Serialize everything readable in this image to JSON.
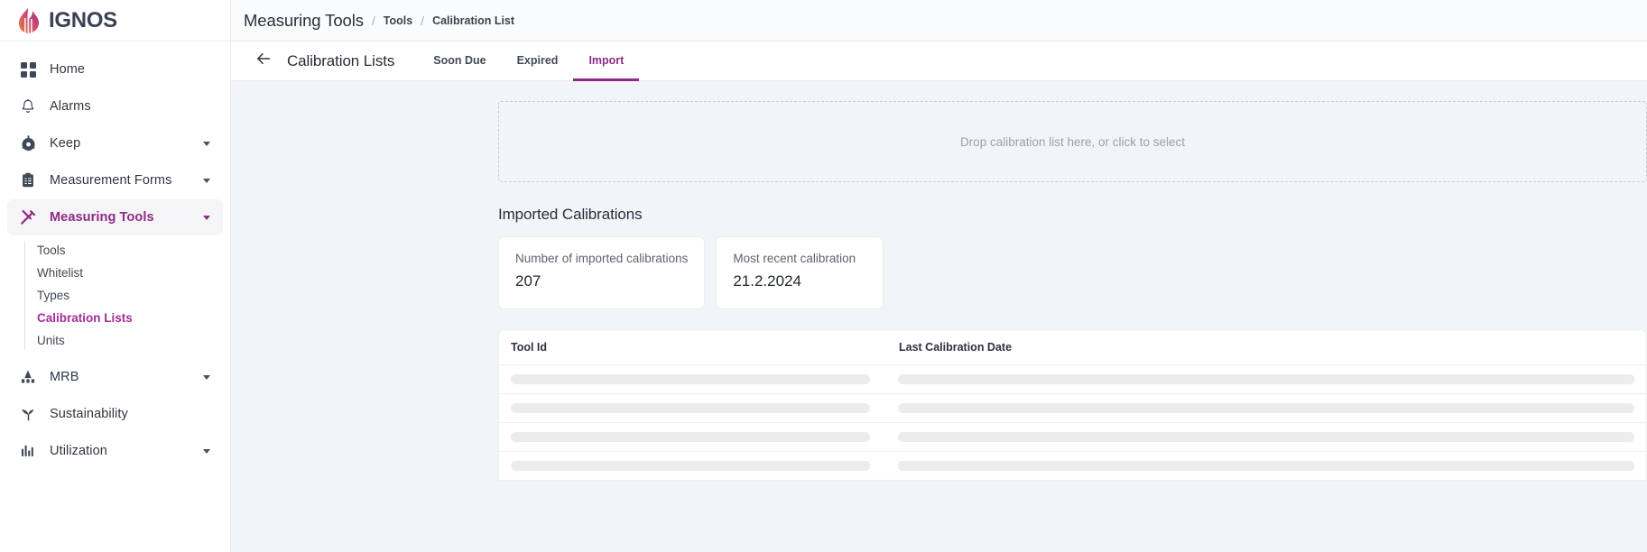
{
  "brand": {
    "name": "IGNOS",
    "logo_icon": "flame-logo-icon"
  },
  "sidebar": {
    "items": [
      {
        "label": "Home",
        "icon": "grid-icon",
        "active": false,
        "expandable": false
      },
      {
        "label": "Alarms",
        "icon": "bell-icon",
        "active": false,
        "expandable": false
      },
      {
        "label": "Keep",
        "icon": "chuck-icon",
        "active": false,
        "expandable": true
      },
      {
        "label": "Measurement Forms",
        "icon": "clipboard-check-icon",
        "active": false,
        "expandable": true
      },
      {
        "label": "Measuring Tools",
        "icon": "caliper-tools-icon",
        "active": true,
        "expandable": true
      },
      {
        "label": "MRB",
        "icon": "factory-icon",
        "active": false,
        "expandable": true
      },
      {
        "label": "Sustainability",
        "icon": "sprout-icon",
        "active": false,
        "expandable": false
      },
      {
        "label": "Utilization",
        "icon": "bar-chart-icon",
        "active": false,
        "expandable": true
      }
    ],
    "subitems": [
      {
        "label": "Tools",
        "active": false
      },
      {
        "label": "Whitelist",
        "active": false
      },
      {
        "label": "Types",
        "active": false
      },
      {
        "label": "Calibration Lists",
        "active": true
      },
      {
        "label": "Units",
        "active": false
      }
    ]
  },
  "header": {
    "title": "Measuring Tools",
    "separator": "/",
    "breadcrumb": [
      "Tools",
      "Calibration List"
    ]
  },
  "tabbar": {
    "back_icon": "arrow-left-icon",
    "page_title": "Calibration Lists",
    "tabs": [
      {
        "label": "Soon Due",
        "active": false
      },
      {
        "label": "Expired",
        "active": false
      },
      {
        "label": "Import",
        "active": true
      }
    ]
  },
  "main": {
    "dropzone_text": "Drop calibration list here, or click to select",
    "section_title": "Imported Calibrations",
    "stats": [
      {
        "label": "Number of imported calibrations",
        "value": "207"
      },
      {
        "label": "Most recent calibration",
        "value": "21.2.2024"
      }
    ],
    "table": {
      "columns": [
        "Tool Id",
        "Last Calibration Date"
      ],
      "rows": [
        {
          "tool_id": "",
          "last_calibration_date": ""
        },
        {
          "tool_id": "",
          "last_calibration_date": ""
        },
        {
          "tool_id": "",
          "last_calibration_date": ""
        },
        {
          "tool_id": "",
          "last_calibration_date": ""
        }
      ]
    }
  },
  "colors": {
    "accent": "#8e2b86",
    "sub_accent": "#a32d99",
    "text": "#2f3640",
    "muted": "#9aa2ac",
    "content_bg": "#f2f5f8",
    "border": "#e8e9ec"
  }
}
